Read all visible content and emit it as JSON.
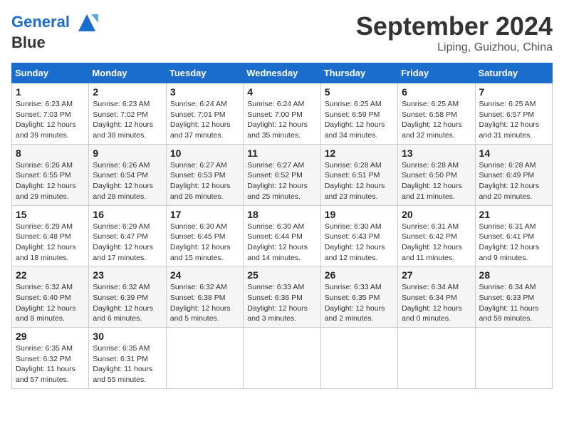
{
  "header": {
    "logo_line1": "General",
    "logo_line2": "Blue",
    "month": "September 2024",
    "location": "Liping, Guizhou, China"
  },
  "weekdays": [
    "Sunday",
    "Monday",
    "Tuesday",
    "Wednesday",
    "Thursday",
    "Friday",
    "Saturday"
  ],
  "weeks": [
    [
      {
        "day": "1",
        "sunrise": "6:23 AM",
        "sunset": "7:03 PM",
        "daylight": "12 hours and 39 minutes."
      },
      {
        "day": "2",
        "sunrise": "6:23 AM",
        "sunset": "7:02 PM",
        "daylight": "12 hours and 38 minutes."
      },
      {
        "day": "3",
        "sunrise": "6:24 AM",
        "sunset": "7:01 PM",
        "daylight": "12 hours and 37 minutes."
      },
      {
        "day": "4",
        "sunrise": "6:24 AM",
        "sunset": "7:00 PM",
        "daylight": "12 hours and 35 minutes."
      },
      {
        "day": "5",
        "sunrise": "6:25 AM",
        "sunset": "6:59 PM",
        "daylight": "12 hours and 34 minutes."
      },
      {
        "day": "6",
        "sunrise": "6:25 AM",
        "sunset": "6:58 PM",
        "daylight": "12 hours and 32 minutes."
      },
      {
        "day": "7",
        "sunrise": "6:25 AM",
        "sunset": "6:57 PM",
        "daylight": "12 hours and 31 minutes."
      }
    ],
    [
      {
        "day": "8",
        "sunrise": "6:26 AM",
        "sunset": "6:55 PM",
        "daylight": "12 hours and 29 minutes."
      },
      {
        "day": "9",
        "sunrise": "6:26 AM",
        "sunset": "6:54 PM",
        "daylight": "12 hours and 28 minutes."
      },
      {
        "day": "10",
        "sunrise": "6:27 AM",
        "sunset": "6:53 PM",
        "daylight": "12 hours and 26 minutes."
      },
      {
        "day": "11",
        "sunrise": "6:27 AM",
        "sunset": "6:52 PM",
        "daylight": "12 hours and 25 minutes."
      },
      {
        "day": "12",
        "sunrise": "6:28 AM",
        "sunset": "6:51 PM",
        "daylight": "12 hours and 23 minutes."
      },
      {
        "day": "13",
        "sunrise": "6:28 AM",
        "sunset": "6:50 PM",
        "daylight": "12 hours and 21 minutes."
      },
      {
        "day": "14",
        "sunrise": "6:28 AM",
        "sunset": "6:49 PM",
        "daylight": "12 hours and 20 minutes."
      }
    ],
    [
      {
        "day": "15",
        "sunrise": "6:29 AM",
        "sunset": "6:48 PM",
        "daylight": "12 hours and 18 minutes."
      },
      {
        "day": "16",
        "sunrise": "6:29 AM",
        "sunset": "6:47 PM",
        "daylight": "12 hours and 17 minutes."
      },
      {
        "day": "17",
        "sunrise": "6:30 AM",
        "sunset": "6:45 PM",
        "daylight": "12 hours and 15 minutes."
      },
      {
        "day": "18",
        "sunrise": "6:30 AM",
        "sunset": "6:44 PM",
        "daylight": "12 hours and 14 minutes."
      },
      {
        "day": "19",
        "sunrise": "6:30 AM",
        "sunset": "6:43 PM",
        "daylight": "12 hours and 12 minutes."
      },
      {
        "day": "20",
        "sunrise": "6:31 AM",
        "sunset": "6:42 PM",
        "daylight": "12 hours and 11 minutes."
      },
      {
        "day": "21",
        "sunrise": "6:31 AM",
        "sunset": "6:41 PM",
        "daylight": "12 hours and 9 minutes."
      }
    ],
    [
      {
        "day": "22",
        "sunrise": "6:32 AM",
        "sunset": "6:40 PM",
        "daylight": "12 hours and 8 minutes."
      },
      {
        "day": "23",
        "sunrise": "6:32 AM",
        "sunset": "6:39 PM",
        "daylight": "12 hours and 6 minutes."
      },
      {
        "day": "24",
        "sunrise": "6:32 AM",
        "sunset": "6:38 PM",
        "daylight": "12 hours and 5 minutes."
      },
      {
        "day": "25",
        "sunrise": "6:33 AM",
        "sunset": "6:36 PM",
        "daylight": "12 hours and 3 minutes."
      },
      {
        "day": "26",
        "sunrise": "6:33 AM",
        "sunset": "6:35 PM",
        "daylight": "12 hours and 2 minutes."
      },
      {
        "day": "27",
        "sunrise": "6:34 AM",
        "sunset": "6:34 PM",
        "daylight": "12 hours and 0 minutes."
      },
      {
        "day": "28",
        "sunrise": "6:34 AM",
        "sunset": "6:33 PM",
        "daylight": "11 hours and 59 minutes."
      }
    ],
    [
      {
        "day": "29",
        "sunrise": "6:35 AM",
        "sunset": "6:32 PM",
        "daylight": "11 hours and 57 minutes."
      },
      {
        "day": "30",
        "sunrise": "6:35 AM",
        "sunset": "6:31 PM",
        "daylight": "11 hours and 55 minutes."
      },
      null,
      null,
      null,
      null,
      null
    ]
  ]
}
